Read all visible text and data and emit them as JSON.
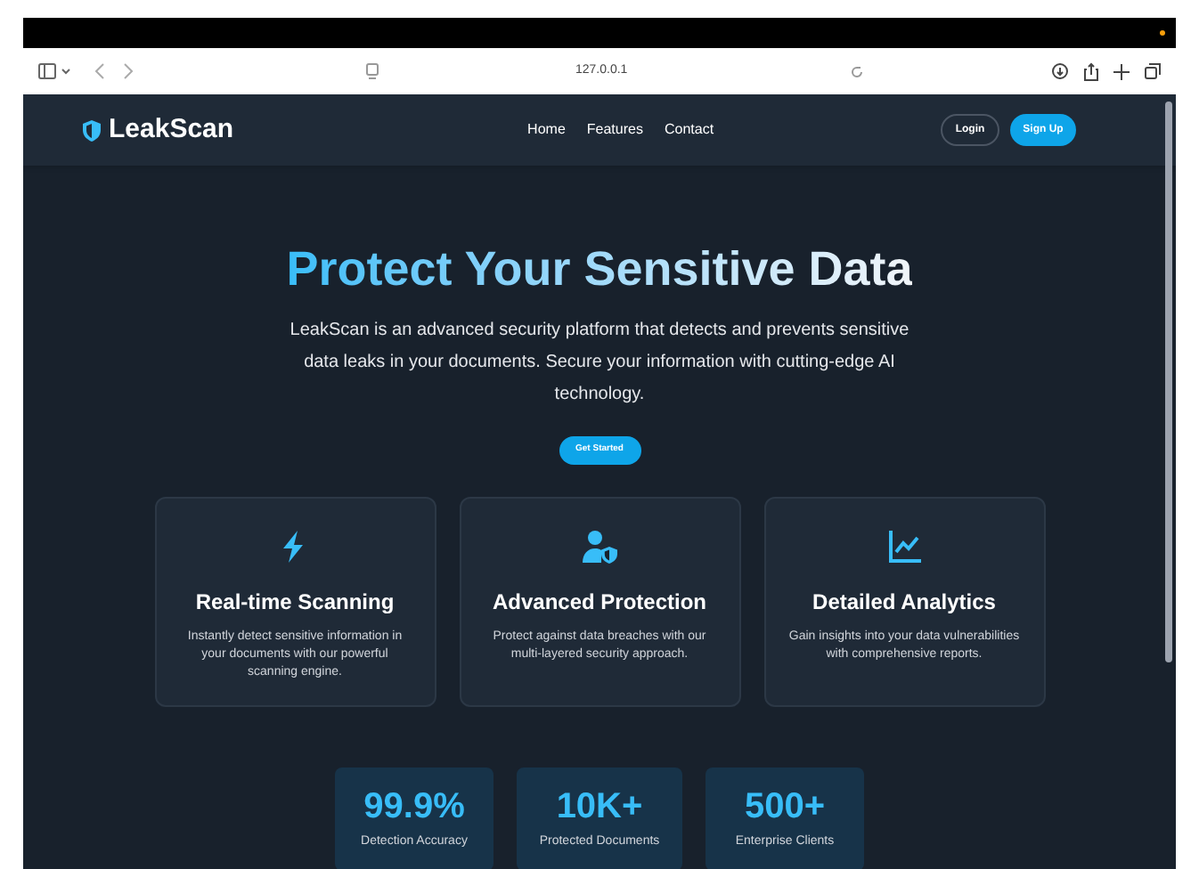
{
  "browser": {
    "address": "127.0.0.1"
  },
  "nav": {
    "brand": "LeakScan",
    "links": [
      "Home",
      "Features",
      "Contact"
    ],
    "login": "Login",
    "signup": "Sign Up"
  },
  "hero": {
    "title": "Protect Your Sensitive Data",
    "text": "LeakScan is an advanced security platform that detects and prevents sensitive data leaks in your documents. Secure your information with cutting-edge AI technology.",
    "button": "Get Started"
  },
  "features": [
    {
      "kind": "bolt",
      "title": "Real-time Scanning",
      "text": "Instantly detect sensitive information in your documents with our powerful scanning engine."
    },
    {
      "kind": "user-shield",
      "title": "Advanced Protection",
      "text": "Protect against data breaches with our multi-layered security approach."
    },
    {
      "kind": "chart",
      "title": "Detailed Analytics",
      "text": "Gain insights into your data vulnerabilities with comprehensive reports."
    }
  ],
  "stats": [
    {
      "value": "99.9%",
      "label": "Detection Accuracy"
    },
    {
      "value": "10K+",
      "label": "Protected Documents"
    },
    {
      "value": "500+",
      "label": "Enterprise Clients"
    }
  ]
}
